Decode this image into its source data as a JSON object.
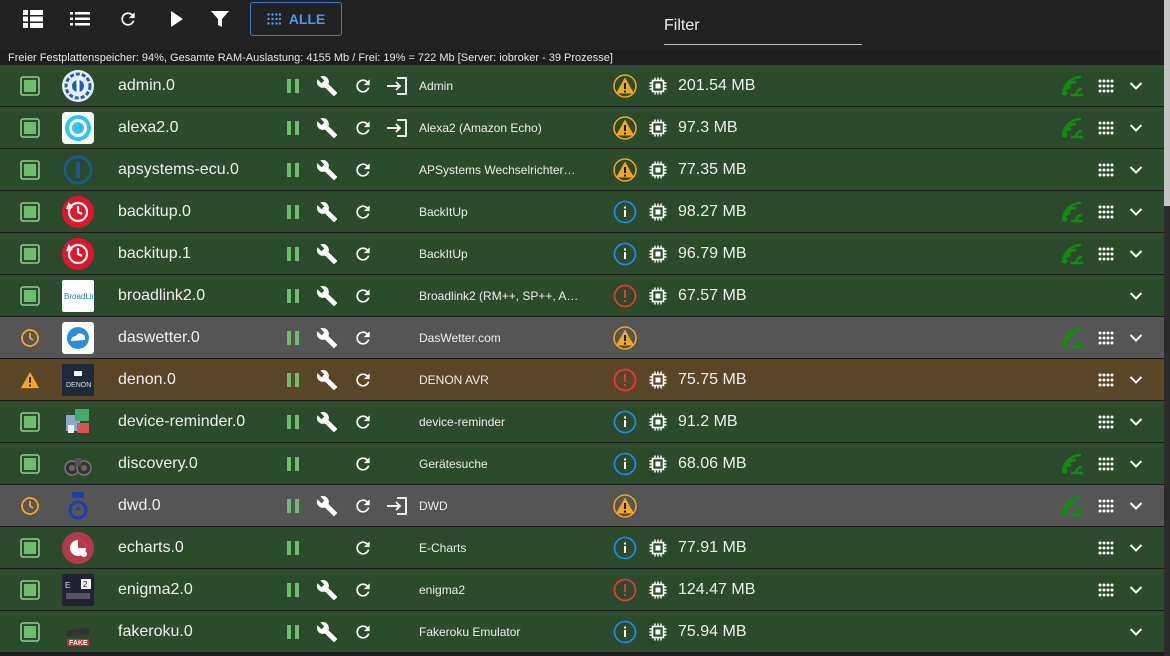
{
  "toolbar": {
    "view_tiles_icon": "view-list-icon",
    "view_list_icon": "list-icon",
    "refresh_icon": "refresh-icon",
    "play_icon": "play-icon",
    "filter_icon": "funnel-icon",
    "alle_label": "ALLE",
    "filter_placeholder": "Filter"
  },
  "statusline": "Freier Festplattenspeicher: 94%, Gesamte RAM-Auslastung: 4155 Mb / Frei: 19% = 722 Mb [Server: iobroker - 39 Prozesse]",
  "colors": {
    "row_green": "#2c4a2c",
    "row_gray": "#555555",
    "row_orange": "#5a4526",
    "status_green": "#6dbd6d",
    "warn_orange": "#f5a623",
    "error_red": "#e53935",
    "info_blue": "#1e88e5",
    "connected_green": "#138a13",
    "accent_blue": "#4d9be8"
  },
  "rows": [
    {
      "name": "admin.0",
      "title": "Admin",
      "memory": "201.54 MB",
      "level": "warn",
      "status": "ok",
      "bg": "green",
      "wrench": true,
      "link": true,
      "conn": true,
      "grid": true,
      "logo": "admin-logo"
    },
    {
      "name": "alexa2.0",
      "title": "Alexa2 (Amazon Echo)",
      "memory": "97.3 MB",
      "level": "warn",
      "status": "ok",
      "bg": "green",
      "wrench": true,
      "link": true,
      "conn": true,
      "grid": true,
      "logo": "alexa-logo"
    },
    {
      "name": "apsystems-ecu.0",
      "title": "APSystems Wechselrichter…",
      "memory": "77.35 MB",
      "level": "warn",
      "status": "ok",
      "bg": "green",
      "wrench": true,
      "link": false,
      "conn": false,
      "grid": true,
      "logo": "apsystems-logo"
    },
    {
      "name": "backitup.0",
      "title": "BackItUp",
      "memory": "98.27 MB",
      "level": "info",
      "status": "ok",
      "bg": "green",
      "wrench": true,
      "link": false,
      "conn": true,
      "grid": true,
      "logo": "backitup-logo"
    },
    {
      "name": "backitup.1",
      "title": "BackItUp",
      "memory": "96.79 MB",
      "level": "info",
      "status": "ok",
      "bg": "green",
      "wrench": true,
      "link": false,
      "conn": true,
      "grid": true,
      "logo": "backitup-logo"
    },
    {
      "name": "broadlink2.0",
      "title": "Broadlink2 (RM++, SP++, A…",
      "memory": "67.57 MB",
      "level": "error",
      "status": "ok",
      "bg": "green",
      "wrench": true,
      "link": false,
      "conn": false,
      "grid": false,
      "logo": "broadlink-logo"
    },
    {
      "name": "daswetter.0",
      "title": "DasWetter.com",
      "memory": "",
      "level": "warn",
      "status": "schedule",
      "bg": "gray",
      "wrench": true,
      "link": false,
      "conn": true,
      "grid": true,
      "logo": "daswetter-logo"
    },
    {
      "name": "denon.0",
      "title": "DENON AVR",
      "memory": "75.75 MB",
      "level": "error",
      "status": "warning",
      "bg": "orange",
      "wrench": true,
      "link": false,
      "conn": false,
      "grid": true,
      "logo": "denon-logo"
    },
    {
      "name": "device-reminder.0",
      "title": "device-reminder",
      "memory": "91.2 MB",
      "level": "info",
      "status": "ok",
      "bg": "green",
      "wrench": true,
      "link": false,
      "conn": false,
      "grid": true,
      "logo": "device-reminder-logo"
    },
    {
      "name": "discovery.0",
      "title": "Gerätesuche",
      "memory": "68.06 MB",
      "level": "info",
      "status": "ok",
      "bg": "green",
      "wrench": false,
      "link": false,
      "conn": true,
      "grid": true,
      "logo": "discovery-logo"
    },
    {
      "name": "dwd.0",
      "title": "DWD",
      "memory": "",
      "level": "warn",
      "status": "schedule",
      "bg": "gray",
      "wrench": true,
      "link": true,
      "conn": true,
      "grid": true,
      "logo": "dwd-logo"
    },
    {
      "name": "echarts.0",
      "title": "E-Charts",
      "memory": "77.91 MB",
      "level": "info",
      "status": "ok",
      "bg": "green",
      "wrench": false,
      "link": false,
      "conn": false,
      "grid": true,
      "logo": "echarts-logo"
    },
    {
      "name": "enigma2.0",
      "title": "enigma2",
      "memory": "124.47 MB",
      "level": "error",
      "status": "ok",
      "bg": "green",
      "wrench": true,
      "link": false,
      "conn": false,
      "grid": true,
      "logo": "enigma2-logo"
    },
    {
      "name": "fakeroku.0",
      "title": "Fakeroku Emulator",
      "memory": "75.94 MB",
      "level": "info",
      "status": "ok",
      "bg": "green",
      "wrench": true,
      "link": false,
      "conn": false,
      "grid": false,
      "logo": "fakeroku-logo"
    }
  ]
}
